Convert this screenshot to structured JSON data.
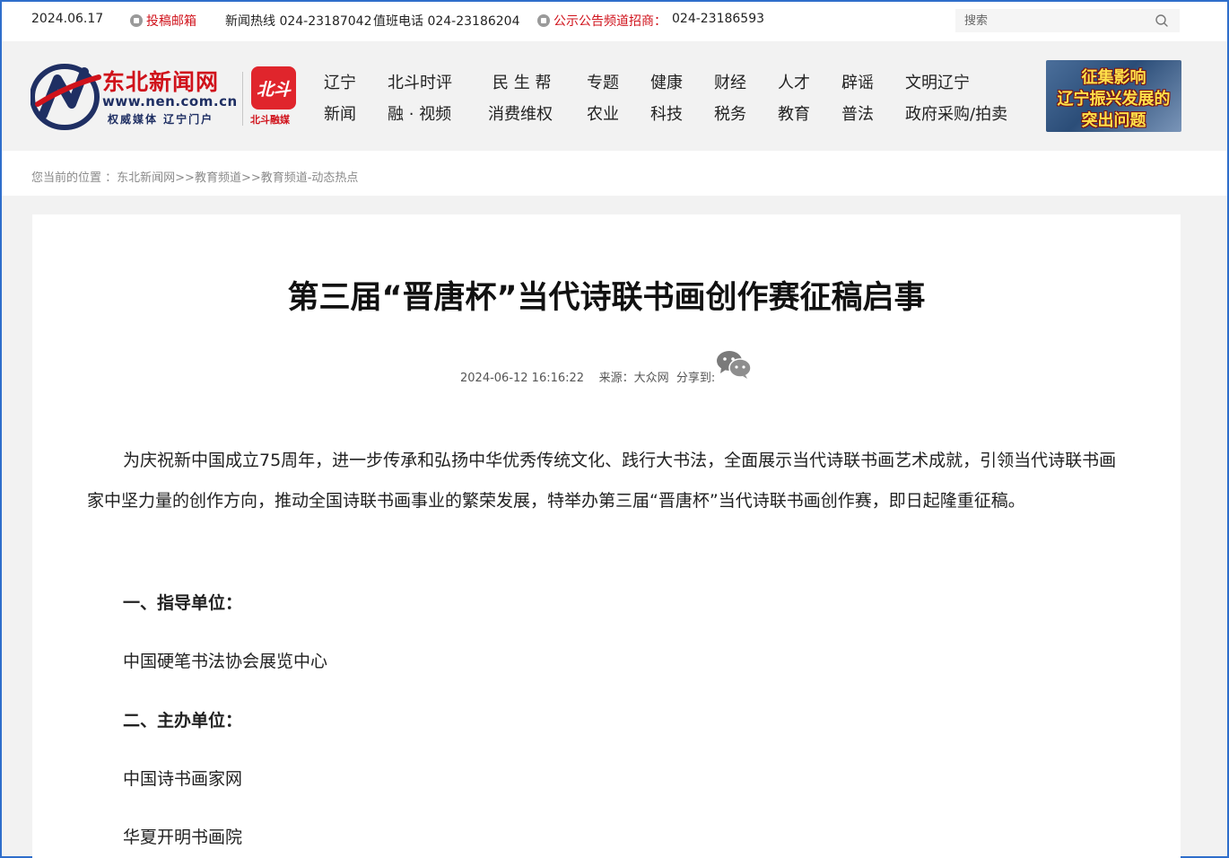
{
  "topbar": {
    "date": "2024.06.17",
    "contribute_label": "投稿邮箱",
    "hotline": "新闻热线 024-23187042",
    "duty_phone": "值班电话 024-23186204",
    "notice_label": "公示公告频道招商：",
    "notice_phone": "024-23186593",
    "search_placeholder": "搜索"
  },
  "logo": {
    "name": "东北新闻网",
    "url": "www.nen.com.cn",
    "slogan": "权威媒体 辽宁门户",
    "beidou_badge": "北斗",
    "beidou_label": "北斗融媒"
  },
  "nav": [
    {
      "top": "辽宁",
      "bottom": "新闻"
    },
    {
      "top": "北斗时评",
      "bottom": "融 · 视频"
    },
    {
      "top": "民 生 帮",
      "bottom": "消费维权"
    },
    {
      "top": "专题",
      "bottom": "农业"
    },
    {
      "top": "健康",
      "bottom": "科技"
    },
    {
      "top": "财经",
      "bottom": "税务"
    },
    {
      "top": "人才",
      "bottom": "教育"
    },
    {
      "top": "辟谣",
      "bottom": "普法"
    },
    {
      "top": "文明辽宁",
      "bottom": "政府采购/拍卖"
    }
  ],
  "banner": {
    "line1": "征集影响",
    "line2": "辽宁振兴发展的",
    "line3": "突出问题"
  },
  "breadcrumb": {
    "prefix": "您当前的位置 ：",
    "items": [
      "东北新闻网",
      ">>教育频道",
      ">>教育频道-动态热点"
    ]
  },
  "article": {
    "title": "第三届“晋唐杯”当代诗联书画创作赛征稿启事",
    "datetime": "2024-06-12 16:16:22",
    "source": "来源：大众网",
    "share_label": "分享到:",
    "intro": "为庆祝新中国成立75周年，进一步传承和弘扬中华优秀传统文化、践行大书法，全面展示当代诗联书画艺术成就，引领当代诗联书画家中坚力量的创作方向，推动全国诗联书画事业的繁荣发展，特举办第三届“晋唐杯”当代诗联书画创作赛，即日起隆重征稿。",
    "section1_title": "一、指导单位：",
    "section1_item": "中国硬笔书法协会展览中心",
    "section2_title": "二、主办单位：",
    "section2_items": [
      "中国诗书画家网",
      "华夏开明书画院"
    ]
  },
  "colors": {
    "accent_red": "#d0121b",
    "logo_navy": "#1f2f63",
    "frame_blue": "#2f6ecb"
  }
}
